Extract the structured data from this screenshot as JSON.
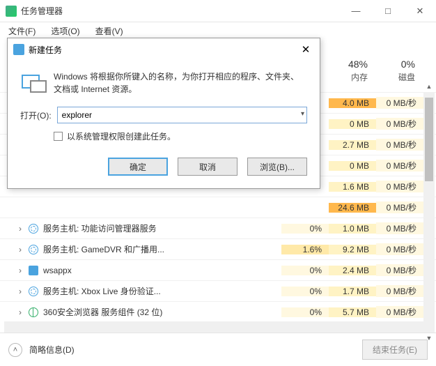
{
  "window": {
    "title": "任务管理器",
    "menu": {
      "file": "文件(F)",
      "options": "选项(O)",
      "view": "查看(V)"
    },
    "min": "—",
    "max": "□",
    "close": "✕"
  },
  "headers": {
    "cpu": {
      "pct": "",
      "lab": ""
    },
    "mem": {
      "pct": "48%",
      "lab": "内存"
    },
    "dsk": {
      "pct": "0%",
      "lab": "磁盘"
    }
  },
  "rows": [
    {
      "cpu": "",
      "mem": "4.0 MB",
      "dsk": "0 MB/秒",
      "name": "",
      "hot": true
    },
    {
      "cpu": "",
      "mem": "0 MB",
      "dsk": "0 MB/秒",
      "name": ""
    },
    {
      "cpu": "",
      "mem": "2.7 MB",
      "dsk": "0 MB/秒",
      "name": ""
    },
    {
      "cpu": "",
      "mem": "0 MB",
      "dsk": "0 MB/秒",
      "name": ""
    },
    {
      "cpu": "",
      "mem": "1.6 MB",
      "dsk": "0 MB/秒",
      "name": ""
    },
    {
      "cpu": "",
      "mem": "24.6 MB",
      "dsk": "0 MB/秒",
      "name": "",
      "hot": true
    },
    {
      "cpu": "0%",
      "mem": "1.0 MB",
      "dsk": "0 MB/秒",
      "name": "服务主机: 功能访问管理器服务",
      "exp": true,
      "icon": "gear"
    },
    {
      "cpu": "1.6%",
      "mem": "9.2 MB",
      "dsk": "0 MB/秒",
      "name": "服务主机: GameDVR 和广播用...",
      "exp": true,
      "icon": "gear",
      "cpuhot": true
    },
    {
      "cpu": "0%",
      "mem": "2.4 MB",
      "dsk": "0 MB/秒",
      "name": "wsappx",
      "exp": true,
      "icon": "shield"
    },
    {
      "cpu": "0%",
      "mem": "1.7 MB",
      "dsk": "0 MB/秒",
      "name": "服务主机: Xbox Live 身份验证...",
      "exp": true,
      "icon": "gear"
    },
    {
      "cpu": "0%",
      "mem": "5.7 MB",
      "dsk": "0 MB/秒",
      "name": "360安全浏览器 服务组件 (32 位)",
      "exp": true,
      "icon": "globe"
    }
  ],
  "footer": {
    "brief": "简略信息(D)",
    "end": "结束任务(E)"
  },
  "dialog": {
    "title": "新建任务",
    "desc": "Windows 将根据你所键入的名称，为你打开相应的程序、文件夹、文档或 Internet 资源。",
    "open_label": "打开(O):",
    "value": "explorer",
    "admin": "以系统管理权限创建此任务。",
    "ok": "确定",
    "cancel": "取消",
    "browse": "浏览(B)..."
  }
}
